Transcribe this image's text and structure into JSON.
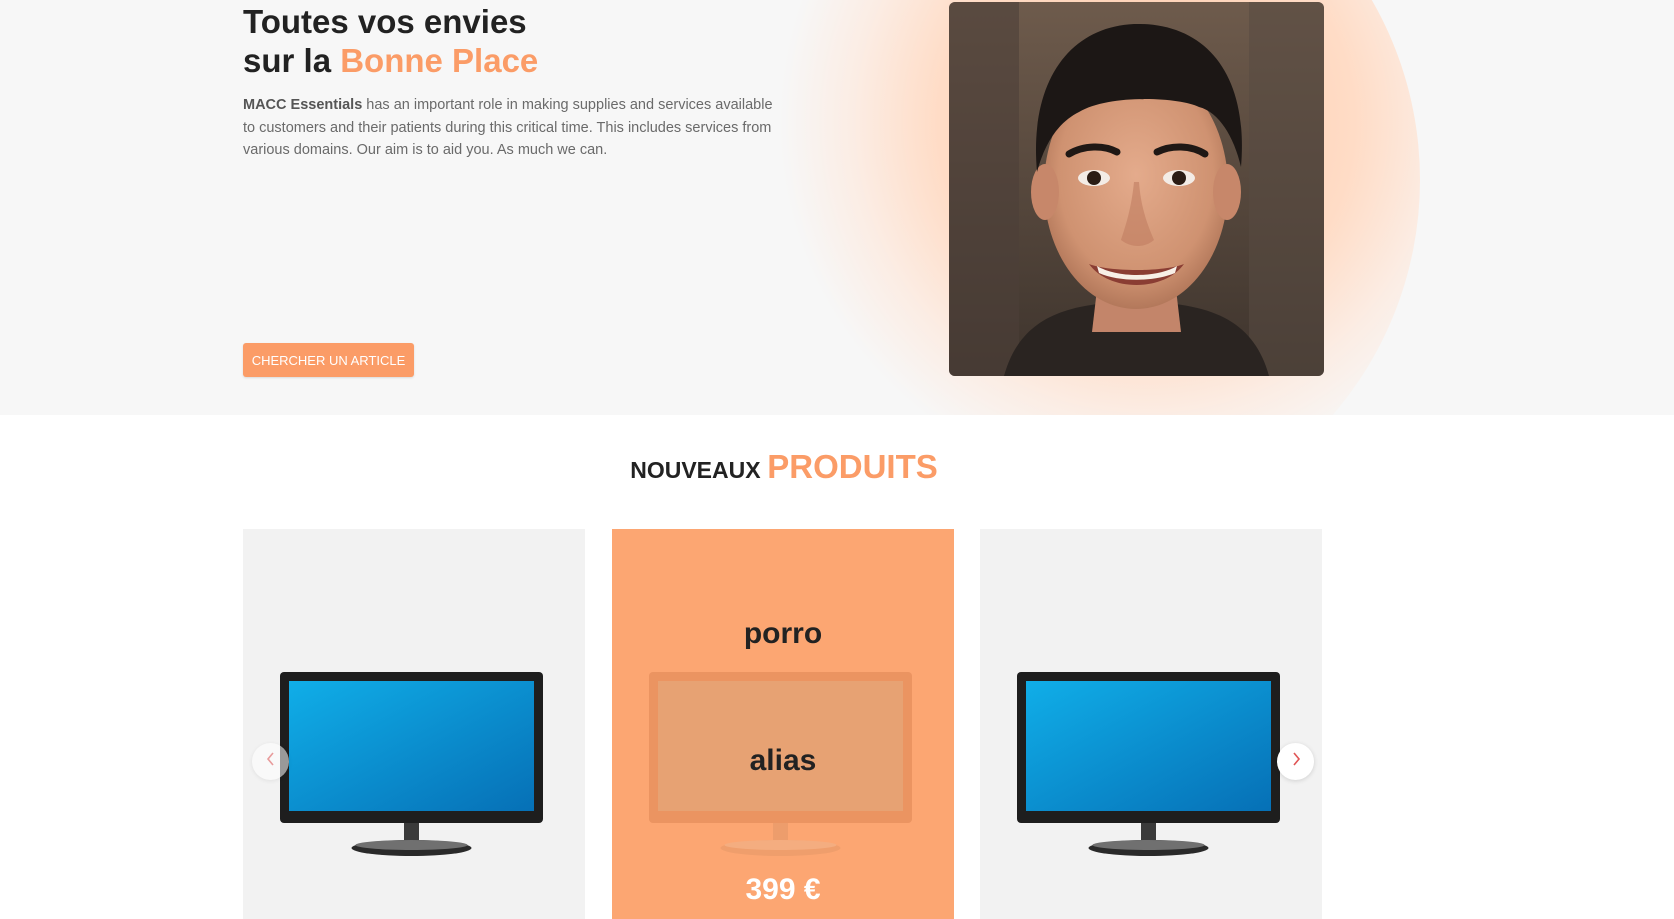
{
  "hero": {
    "title_line1": "Toutes vos envies",
    "title_line2_prefix": "sur la",
    "title_line2_accent": "Bonne Place",
    "description_strong": "MACC Essentials",
    "description_rest": " has an important role in making supplies and services available to customers and their patients during this critical time. This includes services from various domains. Our aim is to aid you. As much we can.",
    "cta_label": "CHERCHER UN ARTICLE",
    "image": "portrait-photo"
  },
  "products_section": {
    "title_small": "NOUVEAUX",
    "title_accent": "PRODUITS"
  },
  "products": [
    {
      "image": "monitor-image"
    },
    {
      "name": "porro",
      "subtitle": "alias",
      "price": "399 €",
      "image": "monitor-image"
    },
    {
      "image": "monitor-image"
    }
  ],
  "carousel": {
    "prev_icon": "chevron-left-icon",
    "next_icon": "chevron-right-icon"
  },
  "colors": {
    "accent": "#fb9c67",
    "card_hover": "#fca672",
    "card_bg": "#f2f2f2",
    "hero_bg": "#f7f7f7",
    "arrow": "#e05555"
  }
}
